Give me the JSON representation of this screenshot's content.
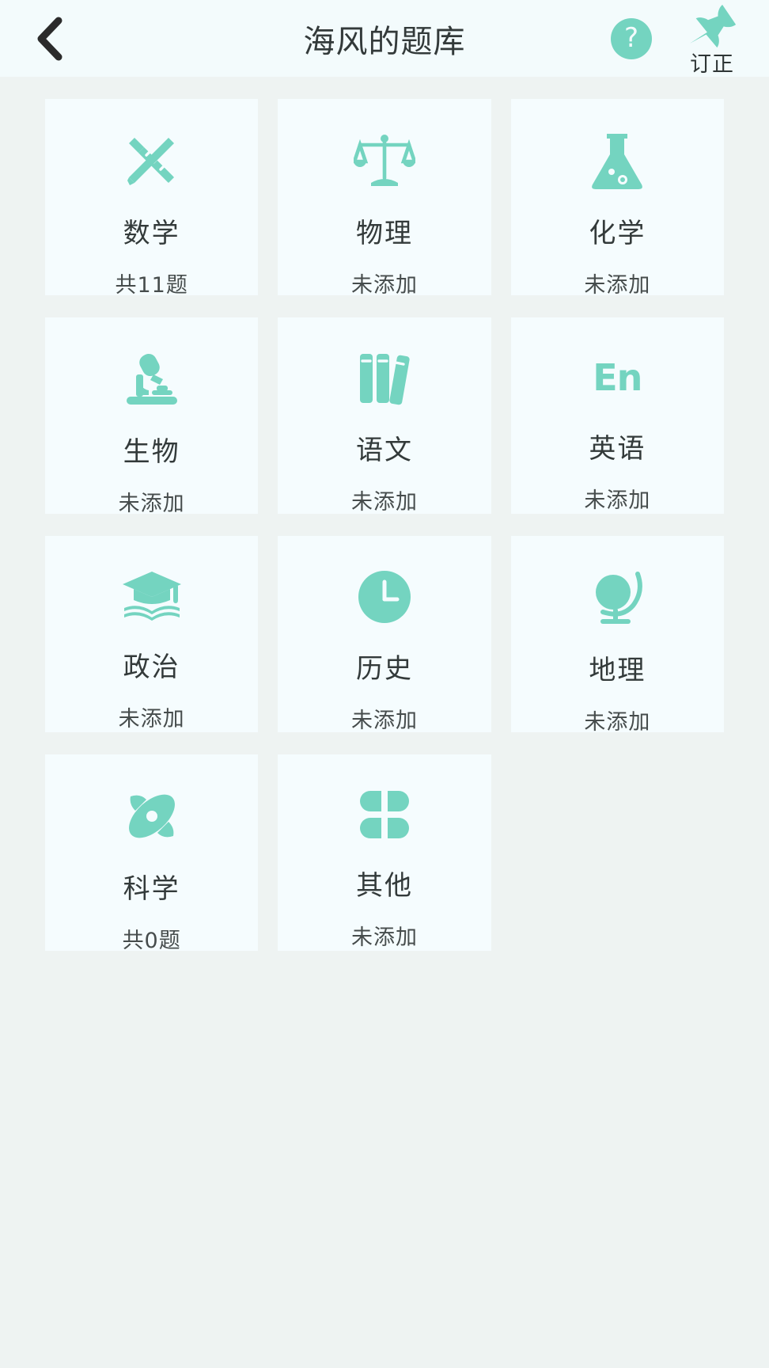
{
  "header": {
    "title": "海风的题库",
    "back_icon": "chevron-left-icon",
    "help_icon": "question-mark-icon",
    "help_glyph": "?",
    "pin_icon": "pushpin-icon",
    "pin_label": "订正"
  },
  "colors": {
    "accent": "#74d4c0",
    "page_background": "#eef3f2",
    "card_background": "#f5fcfe",
    "header_background": "#f3fbfc",
    "title_text": "#333a3a",
    "sub_text": "#464c4c"
  },
  "subjects": [
    {
      "name": "数学",
      "status": "共11题",
      "icon": "pencil-ruler-icon"
    },
    {
      "name": "物理",
      "status": "未添加",
      "icon": "balance-scale-icon"
    },
    {
      "name": "化学",
      "status": "未添加",
      "icon": "flask-icon"
    },
    {
      "name": "生物",
      "status": "未添加",
      "icon": "microscope-icon"
    },
    {
      "name": "语文",
      "status": "未添加",
      "icon": "books-icon"
    },
    {
      "name": "英语",
      "status": "未添加",
      "icon": "en-text-icon",
      "icon_text": "En"
    },
    {
      "name": "政治",
      "status": "未添加",
      "icon": "graduation-cap-book-icon"
    },
    {
      "name": "历史",
      "status": "未添加",
      "icon": "clock-icon"
    },
    {
      "name": "地理",
      "status": "未添加",
      "icon": "globe-stand-icon"
    },
    {
      "name": "科学",
      "status": "共0题",
      "icon": "atom-orbit-icon"
    },
    {
      "name": "其他",
      "status": "未添加",
      "icon": "four-petal-icon"
    }
  ]
}
